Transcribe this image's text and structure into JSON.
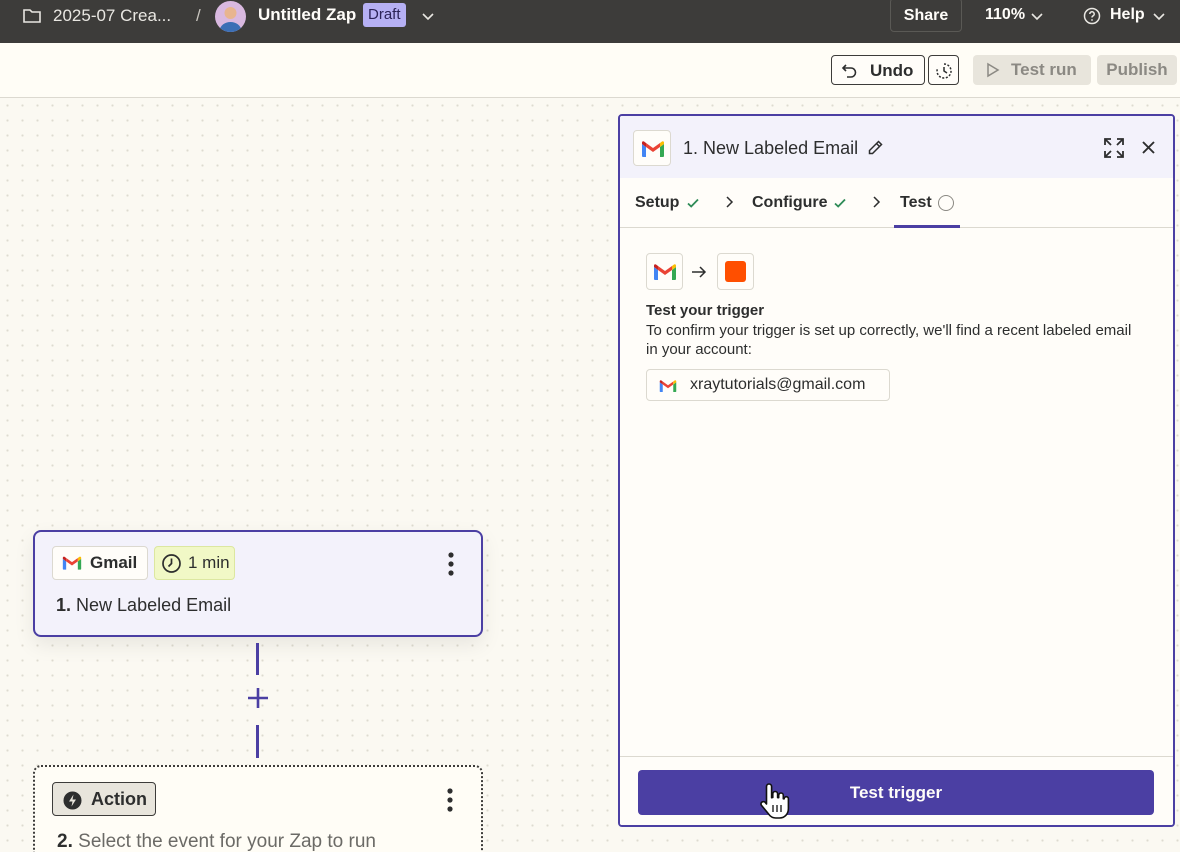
{
  "topbar": {
    "folder_name": "2025-07 Crea...",
    "separator": "/",
    "zap_title": "Untitled Zap",
    "status_badge": "Draft",
    "share_label": "Share",
    "zoom_level": "110%",
    "help_label": "Help"
  },
  "toolbar": {
    "undo_label": "Undo",
    "test_run_label": "Test run",
    "publish_label": "Publish"
  },
  "canvas": {
    "step1": {
      "app_name": "Gmail",
      "poll_interval": "1 min",
      "number": "1.",
      "title": "New Labeled Email"
    },
    "step2": {
      "badge_label": "Action",
      "number": "2.",
      "title": "Select the event for your Zap to run"
    }
  },
  "panel": {
    "number": "1.",
    "title": "New Labeled Email",
    "tabs": [
      {
        "label": "Setup",
        "state": "complete"
      },
      {
        "label": "Configure",
        "state": "complete"
      },
      {
        "label": "Test",
        "state": "active"
      }
    ],
    "test_heading": "Test your trigger",
    "test_description": "To confirm your trigger is set up correctly, we'll find a recent labeled email in your account:",
    "account_email": "xraytutorials@gmail.com",
    "primary_button": "Test trigger"
  },
  "colors": {
    "accent": "#4b3fa3",
    "topbar_bg": "#3d3c3a",
    "draft_badge": "#b6b0f4",
    "zapier_orange": "#ff4f00",
    "check_green": "#2e8b57"
  }
}
